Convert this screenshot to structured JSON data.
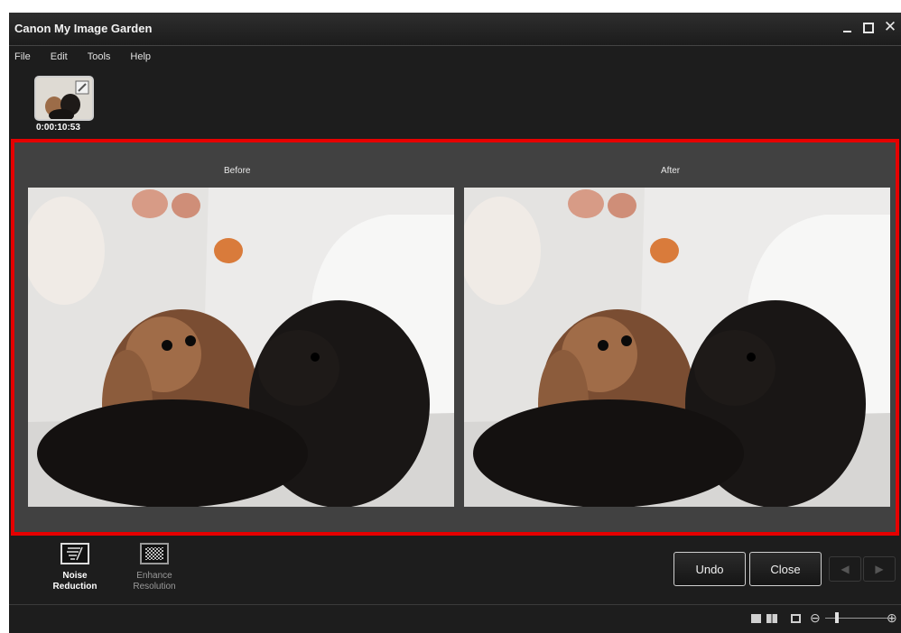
{
  "window": {
    "title": "Canon My Image Garden"
  },
  "menu": [
    "File",
    "Edit",
    "Tools",
    "Help"
  ],
  "thumbnail": {
    "timecode": "0:00:10:53"
  },
  "preview": {
    "before_label": "Before",
    "after_label": "After"
  },
  "tools": [
    {
      "label_line1": "Noise",
      "label_line2": "Reduction",
      "active": true
    },
    {
      "label_line1": "Enhance",
      "label_line2": "Resolution",
      "active": false
    }
  ],
  "buttons": {
    "undo": "Undo",
    "close": "Close"
  },
  "colors": {
    "highlight_border": "#e60000",
    "window_bg": "#1d1d1d",
    "preview_bg": "#414141"
  }
}
